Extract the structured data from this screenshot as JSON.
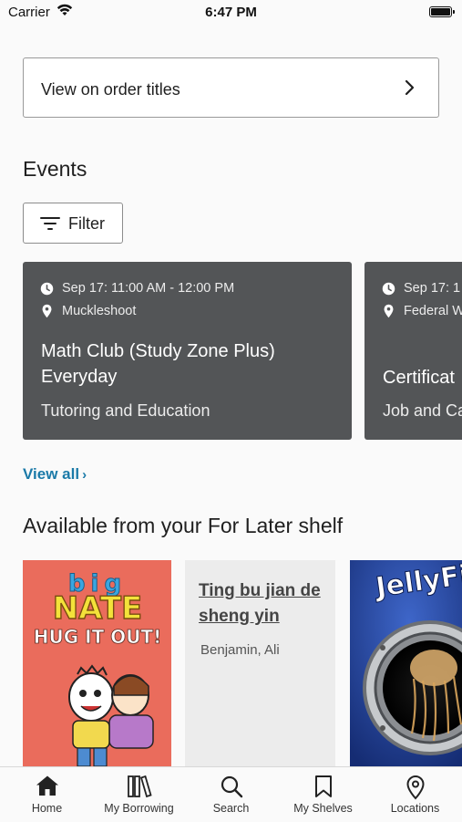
{
  "status_bar": {
    "carrier": "Carrier",
    "time": "6:47 PM"
  },
  "order_link": {
    "label": "View on order titles"
  },
  "events": {
    "title": "Events",
    "filter_label": "Filter",
    "cards": [
      {
        "time": "Sep 17: 11:00 AM - 12:00 PM",
        "location": "Muckleshoot",
        "title": "Math Club (Study Zone Plus) Everyday",
        "category": "Tutoring and Education"
      },
      {
        "time": "Sep 17: 1",
        "location": "Federal W",
        "title": "Certificat",
        "category": "Job and Ca"
      }
    ],
    "view_all": "View all"
  },
  "shelf": {
    "title": "Available from your For Later shelf",
    "books": [
      {
        "cover_text_top": "big",
        "cover_text_mid": "NATE",
        "cover_text_bottom": "HUG IT OUT!"
      },
      {
        "title": "Ting bu jian de sheng yin",
        "author": "Benjamin, Ali"
      },
      {
        "cover_text": "JellyFi"
      }
    ]
  },
  "tabbar": {
    "items": [
      {
        "label": "Home",
        "icon": "home-icon"
      },
      {
        "label": "My Borrowing",
        "icon": "books-icon"
      },
      {
        "label": "Search",
        "icon": "search-icon"
      },
      {
        "label": "My Shelves",
        "icon": "bookmark-icon"
      },
      {
        "label": "Locations",
        "icon": "location-pin-icon"
      }
    ]
  },
  "colors": {
    "link": "#1b7aa8",
    "event_card": "#535557",
    "accent_dark": "#1f1f1f"
  }
}
